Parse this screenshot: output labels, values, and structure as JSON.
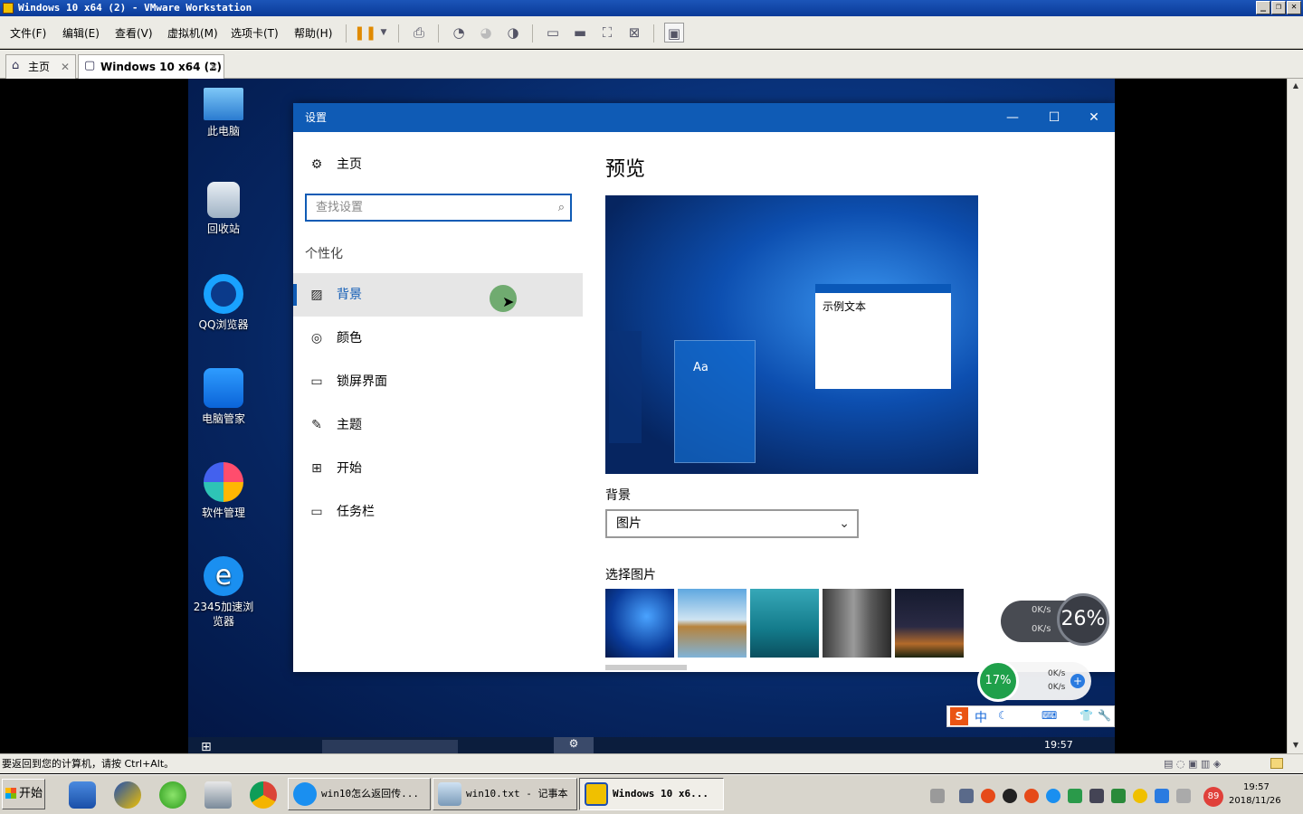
{
  "host": {
    "title": "Windows 10 x64 (2) - VMware Workstation",
    "menu": [
      "文件(F)",
      "编辑(E)",
      "查看(V)",
      "虚拟机(M)",
      "选项卡(T)",
      "帮助(H)"
    ],
    "tabs": [
      {
        "label": "主页"
      },
      {
        "label": "Windows 10 x64 (2)"
      }
    ],
    "status_text": "要返回到您的计算机，请按 Ctrl+Alt。",
    "taskbar": {
      "start_label": "开始",
      "buttons": [
        {
          "label": "win10怎么返回传..."
        },
        {
          "label": "win10.txt - 记事本"
        },
        {
          "label": "Windows 10 x6..."
        }
      ],
      "clock_time": "19:57",
      "clock_date": "2018/11/26",
      "badge": "89"
    }
  },
  "desktop": {
    "icons": [
      {
        "label": "此电脑"
      },
      {
        "label": "回收站"
      },
      {
        "label": "QQ浏览器"
      },
      {
        "label": "电脑管家"
      },
      {
        "label": "软件管理"
      },
      {
        "label": "2345加速浏览器"
      }
    ],
    "widgets": {
      "cpu_a": "26%",
      "cpu_b": "17%",
      "up_speed_a": "0K/s",
      "down_speed_a": "0K/s",
      "up_speed_b": "0K/s",
      "down_speed_b": "0K/s"
    },
    "ime": {
      "lang": "中"
    },
    "vm_clock": "19:57"
  },
  "settings": {
    "title": "设置",
    "home_label": "主页",
    "search_placeholder": "查找设置",
    "section_label": "个性化",
    "nav": [
      {
        "label": "背景",
        "icon": "image-icon"
      },
      {
        "label": "颜色",
        "icon": "palette-icon"
      },
      {
        "label": "锁屏界面",
        "icon": "lock-screen-icon"
      },
      {
        "label": "主题",
        "icon": "theme-icon"
      },
      {
        "label": "开始",
        "icon": "start-icon"
      },
      {
        "label": "任务栏",
        "icon": "taskbar-icon"
      }
    ],
    "preview_heading": "预览",
    "preview_sample_text": "示例文本",
    "preview_tile_label": "Aa",
    "background_label": "背景",
    "background_value": "图片",
    "choose_picture_label": "选择图片"
  }
}
